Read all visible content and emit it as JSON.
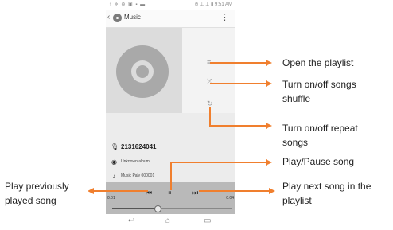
{
  "phone": {
    "status_left": "↑ ≑ ⊕ ▣ ▪ ▬",
    "status_right": "⊘ ⊥ ⊥ ▮ 9:51 AM",
    "app_title": "Music",
    "overflow": "⋮",
    "playlist_icon": "≡",
    "shuffle_icon": "⤨",
    "repeat_icon": "↻",
    "track": {
      "number": "2131624041",
      "album": "Unknown album",
      "artist": "Music Paly 000001"
    },
    "player": {
      "time_elapsed": "0:01",
      "time_total": "0:04",
      "prev_icon": "⏮",
      "play_pause_icon": "⏸",
      "next_icon": "⏭",
      "progress": 0.38
    },
    "nav": {
      "back": "↩",
      "home": "⌂",
      "recents": "▭"
    }
  },
  "callouts": {
    "open_playlist": "Open the playlist",
    "shuffle_line1": "Turn on/off songs",
    "shuffle_line2": "shuffle",
    "repeat_line1": "Turn on/off repeat",
    "repeat_line2": "songs",
    "play_pause": "Play/Pause song",
    "prev_line1": "Play previously",
    "prev_line2": "played song",
    "next_line1": "Play next song in the",
    "next_line2": "playlist"
  },
  "colors": {
    "arrow": "#f07f2e",
    "player_bar": "#b9b9b9",
    "album_art": "#dcdcdc"
  }
}
